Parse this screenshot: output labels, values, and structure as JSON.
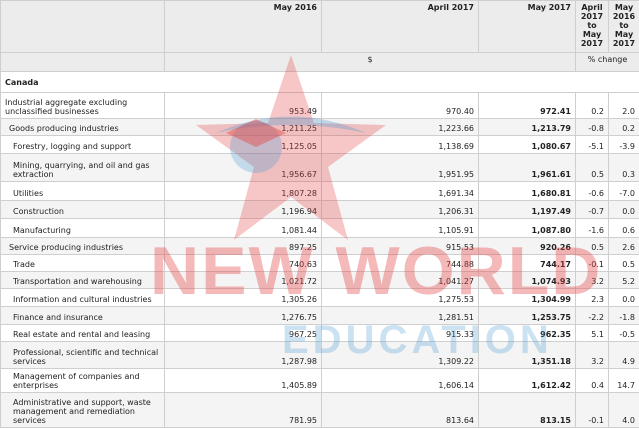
{
  "header": {
    "col_may2016": "May 2016",
    "col_apr2017": "April 2017",
    "col_may2017": "May 2017",
    "col_chg1": [
      "April",
      "2017",
      "to",
      "May",
      "2017"
    ],
    "col_chg2": [
      "May",
      "2016",
      "to",
      "May",
      "2017"
    ],
    "unit_dollars": "$",
    "unit_pct": "% change"
  },
  "geography": "Canada",
  "rows": [
    {
      "label": "Industrial aggregate excluding unclassified businesses",
      "v1": "953.49",
      "v2": "970.40",
      "v3": "972.41",
      "p1": "0.2",
      "p2": "2.0"
    },
    {
      "label": "Goods producing industries",
      "v1": "1,211.25",
      "v2": "1,223.66",
      "v3": "1,213.79",
      "p1": "-0.8",
      "p2": "0.2"
    },
    {
      "label": "Forestry, logging and support",
      "v1": "1,125.05",
      "v2": "1,138.69",
      "v3": "1,080.67",
      "p1": "-5.1",
      "p2": "-3.9"
    },
    {
      "label": "Mining, quarrying, and oil and gas extraction",
      "v1": "1,956.67",
      "v2": "1,951.95",
      "v3": "1,961.61",
      "p1": "0.5",
      "p2": "0.3"
    },
    {
      "label": "Utilities",
      "v1": "1,807.28",
      "v2": "1,691.34",
      "v3": "1,680.81",
      "p1": "-0.6",
      "p2": "-7.0"
    },
    {
      "label": "Construction",
      "v1": "1,196.94",
      "v2": "1,206.31",
      "v3": "1,197.49",
      "p1": "-0.7",
      "p2": "0.0"
    },
    {
      "label": "Manufacturing",
      "v1": "1,081.44",
      "v2": "1,105.91",
      "v3": "1,087.80",
      "p1": "-1.6",
      "p2": "0.6"
    },
    {
      "label": "Service producing industries",
      "v1": "897.25",
      "v2": "915.53",
      "v3": "920.26",
      "p1": "0.5",
      "p2": "2.6"
    },
    {
      "label": "Trade",
      "v1": "740.63",
      "v2": "744.88",
      "v3": "744.17",
      "p1": "-0.1",
      "p2": "0.5"
    },
    {
      "label": "Transportation and warehousing",
      "v1": "1,021.72",
      "v2": "1,041.27",
      "v3": "1,074.93",
      "p1": "3.2",
      "p2": "5.2"
    },
    {
      "label": "Information and cultural industries",
      "v1": "1,305.26",
      "v2": "1,275.53",
      "v3": "1,304.99",
      "p1": "2.3",
      "p2": "0.0"
    },
    {
      "label": "Finance and insurance",
      "v1": "1,276.75",
      "v2": "1,281.51",
      "v3": "1,253.75",
      "p1": "-2.2",
      "p2": "-1.8"
    },
    {
      "label": "Real estate and rental and leasing",
      "v1": "967.25",
      "v2": "915.33",
      "v3": "962.35",
      "p1": "5.1",
      "p2": "-0.5"
    },
    {
      "label": "Professional, scientific and technical services",
      "v1": "1,287.98",
      "v2": "1,309.22",
      "v3": "1,351.18",
      "p1": "3.2",
      "p2": "4.9"
    },
    {
      "label": "Management of companies and enterprises",
      "v1": "1,405.89",
      "v2": "1,606.14",
      "v3": "1,612.42",
      "p1": "0.4",
      "p2": "14.7"
    },
    {
      "label": "Administrative and support, waste management and remediation services",
      "v1": "781.95",
      "v2": "813.64",
      "v3": "813.15",
      "p1": "-0.1",
      "p2": "4.0"
    }
  ],
  "watermark": {
    "line1": "NEW WORLD",
    "line2": "EDUCATION",
    "red": "#e64646",
    "blue": "#4696d2"
  }
}
